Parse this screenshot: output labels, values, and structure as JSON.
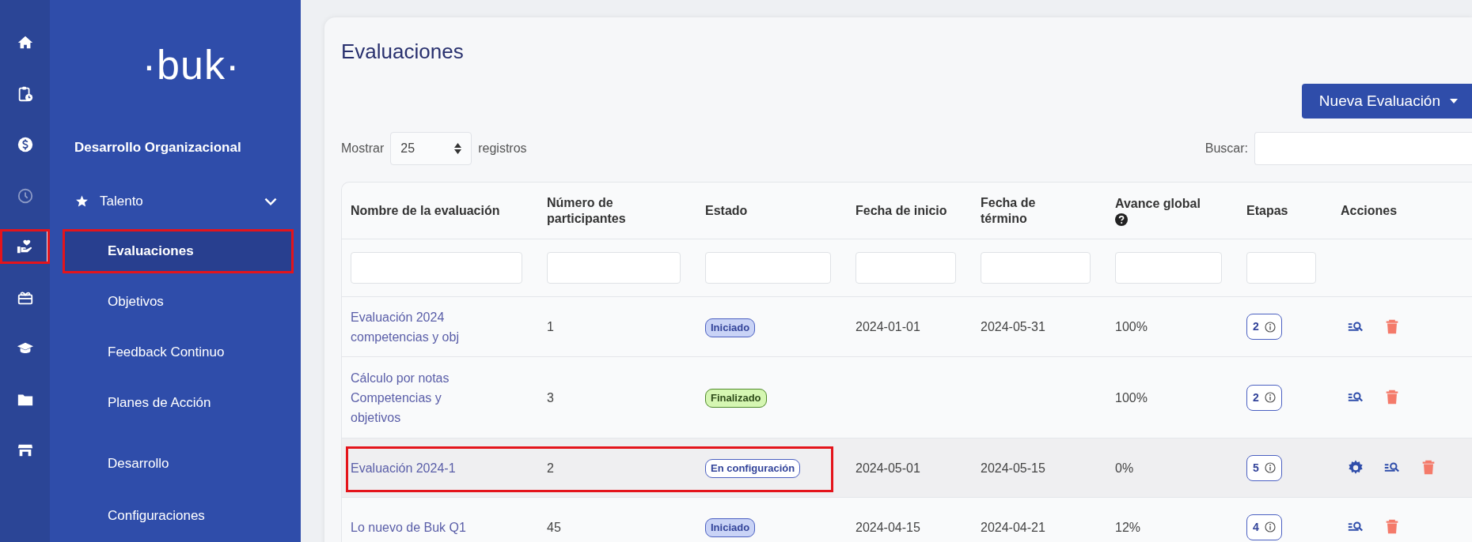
{
  "rail": [
    {
      "kind": "home",
      "selected": false,
      "disabled": false,
      "highlighted": false
    },
    {
      "kind": "clipboard",
      "selected": false,
      "disabled": false,
      "highlighted": false
    },
    {
      "kind": "dollar",
      "selected": false,
      "disabled": false,
      "highlighted": false
    },
    {
      "kind": "clock",
      "selected": false,
      "disabled": true,
      "highlighted": false
    },
    {
      "kind": "hand-heart",
      "selected": true,
      "disabled": false,
      "highlighted": true
    },
    {
      "kind": "gift",
      "selected": false,
      "disabled": false,
      "highlighted": false
    },
    {
      "kind": "cap",
      "selected": false,
      "disabled": false,
      "highlighted": false
    },
    {
      "kind": "folder",
      "selected": false,
      "disabled": false,
      "highlighted": false
    },
    {
      "kind": "store",
      "selected": false,
      "disabled": false,
      "highlighted": false
    }
  ],
  "sidebar": {
    "logo": "·buk·",
    "section": "Desarrollo Organizacional",
    "items": [
      {
        "label": "Talento",
        "expanded": true,
        "children": [
          {
            "label": "Evaluaciones",
            "selected": true,
            "highlighted": true
          },
          {
            "label": "Objetivos",
            "selected": false,
            "highlighted": false
          },
          {
            "label": "Feedback Continuo",
            "selected": false,
            "highlighted": false
          },
          {
            "label": "Planes de Acción",
            "selected": false,
            "highlighted": false
          }
        ]
      },
      {
        "label": "Desarrollo"
      },
      {
        "label": "Configuraciones"
      }
    ]
  },
  "page": {
    "title": "Evaluaciones",
    "new_button": "Nueva Evaluación",
    "length": {
      "before": "Mostrar",
      "value": "25",
      "after": "registros"
    },
    "search": {
      "label": "Buscar:"
    }
  },
  "table": {
    "columns": [
      {
        "label": "Nombre de la evaluación",
        "help": false,
        "filter": true
      },
      {
        "label": "Número de participantes",
        "help": false,
        "filter": true
      },
      {
        "label": "Estado",
        "help": false,
        "filter": true
      },
      {
        "label": "Fecha de inicio",
        "help": false,
        "filter": true
      },
      {
        "label": "Fecha de término",
        "help": false,
        "filter": true
      },
      {
        "label": "Avance global",
        "help": true,
        "filter": true
      },
      {
        "label": "Etapas",
        "help": false,
        "filter": true
      },
      {
        "label": "Acciones",
        "help": false,
        "filter": false
      }
    ],
    "rows": [
      {
        "name": "Evaluación 2024 competencias y obj",
        "participants": "1",
        "status": {
          "kind": "iniciado",
          "label": "Iniciado"
        },
        "start": "2024-01-01",
        "end": "2024-05-31",
        "progress": "100%",
        "stages": "2",
        "actions": [
          {
            "kind": "view"
          },
          {
            "kind": "delete"
          }
        ],
        "highlighted": false
      },
      {
        "name": "Cálculo por notas Competencias y objetivos",
        "participants": "3",
        "status": {
          "kind": "finalizado",
          "label": "Finalizado"
        },
        "start": "",
        "end": "",
        "progress": "100%",
        "stages": "2",
        "actions": [
          {
            "kind": "view"
          },
          {
            "kind": "delete"
          }
        ],
        "highlighted": false
      },
      {
        "name": "Evaluación 2024-1",
        "participants": "2",
        "status": {
          "kind": "configuracion",
          "label": "En configuración"
        },
        "start": "2024-05-01",
        "end": "2024-05-15",
        "progress": "0%",
        "stages": "5",
        "actions": [
          {
            "kind": "settings"
          },
          {
            "kind": "view"
          },
          {
            "kind": "delete"
          }
        ],
        "highlighted": true
      },
      {
        "name": "Lo nuevo de Buk Q1",
        "participants": "45",
        "status": {
          "kind": "iniciado",
          "label": "Iniciado"
        },
        "start": "2024-04-15",
        "end": "2024-04-21",
        "progress": "12%",
        "stages": "4",
        "actions": [
          {
            "kind": "view"
          },
          {
            "kind": "delete"
          }
        ],
        "highlighted": false
      }
    ]
  }
}
